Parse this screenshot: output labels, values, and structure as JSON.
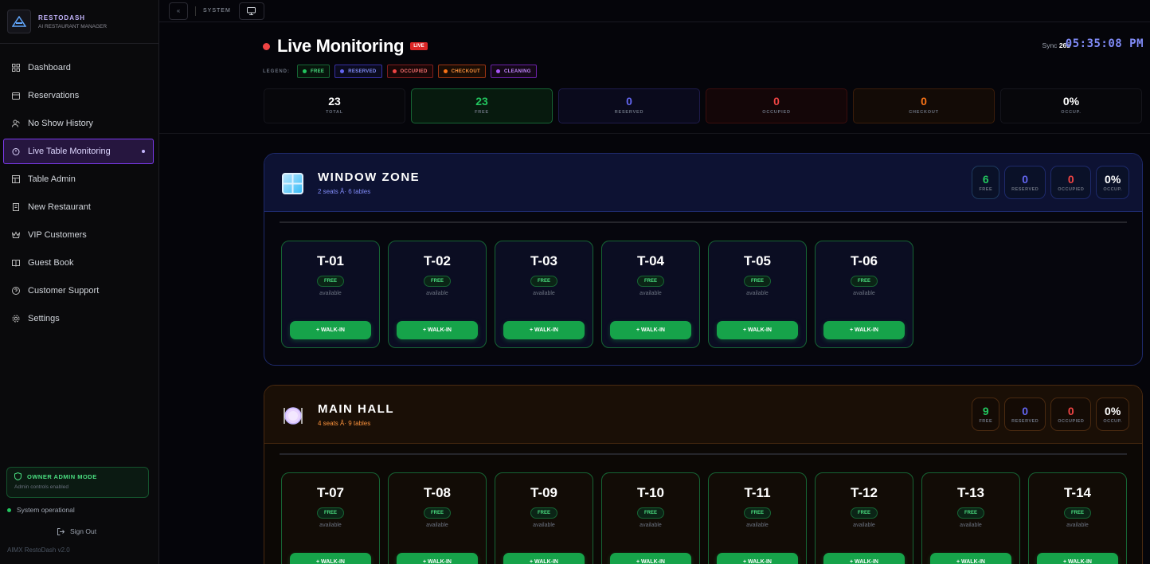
{
  "brand": {
    "name": "RESTODASH",
    "subtitle": "AI RESTAURANT MANAGER"
  },
  "nav": [
    {
      "label": "Dashboard",
      "icon": "grid-icon"
    },
    {
      "label": "Reservations",
      "icon": "calendar-icon"
    },
    {
      "label": "No Show History",
      "icon": "user-x-icon"
    },
    {
      "label": "Live Table Monitoring",
      "icon": "timer-icon",
      "active": true
    },
    {
      "label": "Table Admin",
      "icon": "table-icon"
    },
    {
      "label": "New Restaurant",
      "icon": "building-icon"
    },
    {
      "label": "VIP Customers",
      "icon": "crown-icon"
    },
    {
      "label": "Guest Book",
      "icon": "book-icon"
    },
    {
      "label": "Customer Support",
      "icon": "help-icon"
    },
    {
      "label": "Settings",
      "icon": "gear-icon"
    }
  ],
  "owner": {
    "title": "OWNER ADMIN MODE",
    "subtitle": "Admin controls enabled"
  },
  "system_status": "System operational",
  "signout": "Sign Out",
  "version": "AIMX RestoDash v2.0",
  "topbar": {
    "collapse": "«",
    "label": "SYSTEM"
  },
  "header": {
    "title": "Live Monitoring",
    "badge": "LIVE",
    "sync_label": "Sync",
    "sync_value": "26s",
    "clock": "05:35:08 PM"
  },
  "legend": {
    "label": "LEGEND:",
    "items": [
      {
        "label": "FREE",
        "color": "#22c55e"
      },
      {
        "label": "RESERVED",
        "color": "#6366f1"
      },
      {
        "label": "OCCUPIED",
        "color": "#ef4444"
      },
      {
        "label": "CHECKOUT",
        "color": "#f97316"
      },
      {
        "label": "CLEANING",
        "color": "#a855f7"
      }
    ]
  },
  "stats": [
    {
      "value": "23",
      "label": "TOTAL"
    },
    {
      "value": "23",
      "label": "FREE"
    },
    {
      "value": "0",
      "label": "RESERVED"
    },
    {
      "value": "0",
      "label": "OCCUPIED"
    },
    {
      "value": "0",
      "label": "CHECKOUT"
    },
    {
      "value": "0%",
      "label": "OCCUP."
    }
  ],
  "zones": [
    {
      "name": "WINDOW ZONE",
      "subtitle": "2 seats Â· 6 tables",
      "icon": "window-icon",
      "stats": [
        {
          "value": "6",
          "label": "FREE"
        },
        {
          "value": "0",
          "label": "RESERVED"
        },
        {
          "value": "0",
          "label": "OCCUPIED"
        },
        {
          "value": "0%",
          "label": "OCCUP."
        }
      ],
      "tables": [
        {
          "id": "T-01",
          "status": "FREE",
          "note": "available",
          "action": "+ WALK-IN"
        },
        {
          "id": "T-02",
          "status": "FREE",
          "note": "available",
          "action": "+ WALK-IN"
        },
        {
          "id": "T-03",
          "status": "FREE",
          "note": "available",
          "action": "+ WALK-IN"
        },
        {
          "id": "T-04",
          "status": "FREE",
          "note": "available",
          "action": "+ WALK-IN"
        },
        {
          "id": "T-05",
          "status": "FREE",
          "note": "available",
          "action": "+ WALK-IN"
        },
        {
          "id": "T-06",
          "status": "FREE",
          "note": "available",
          "action": "+ WALK-IN"
        }
      ]
    },
    {
      "name": "MAIN HALL",
      "subtitle": "4 seats Â· 9 tables",
      "icon": "plate-icon",
      "stats": [
        {
          "value": "9",
          "label": "FREE"
        },
        {
          "value": "0",
          "label": "RESERVED"
        },
        {
          "value": "0",
          "label": "OCCUPIED"
        },
        {
          "value": "0%",
          "label": "OCCUP."
        }
      ],
      "tables": [
        {
          "id": "T-07",
          "status": "FREE",
          "note": "available",
          "action": "+ WALK-IN"
        },
        {
          "id": "T-08",
          "status": "FREE",
          "note": "available",
          "action": "+ WALK-IN"
        },
        {
          "id": "T-09",
          "status": "FREE",
          "note": "available",
          "action": "+ WALK-IN"
        },
        {
          "id": "T-10",
          "status": "FREE",
          "note": "available",
          "action": "+ WALK-IN"
        },
        {
          "id": "T-11",
          "status": "FREE",
          "note": "available",
          "action": "+ WALK-IN"
        },
        {
          "id": "T-12",
          "status": "FREE",
          "note": "available",
          "action": "+ WALK-IN"
        },
        {
          "id": "T-13",
          "status": "FREE",
          "note": "available",
          "action": "+ WALK-IN"
        },
        {
          "id": "T-14",
          "status": "FREE",
          "note": "available",
          "action": "+ WALK-IN"
        }
      ]
    }
  ]
}
